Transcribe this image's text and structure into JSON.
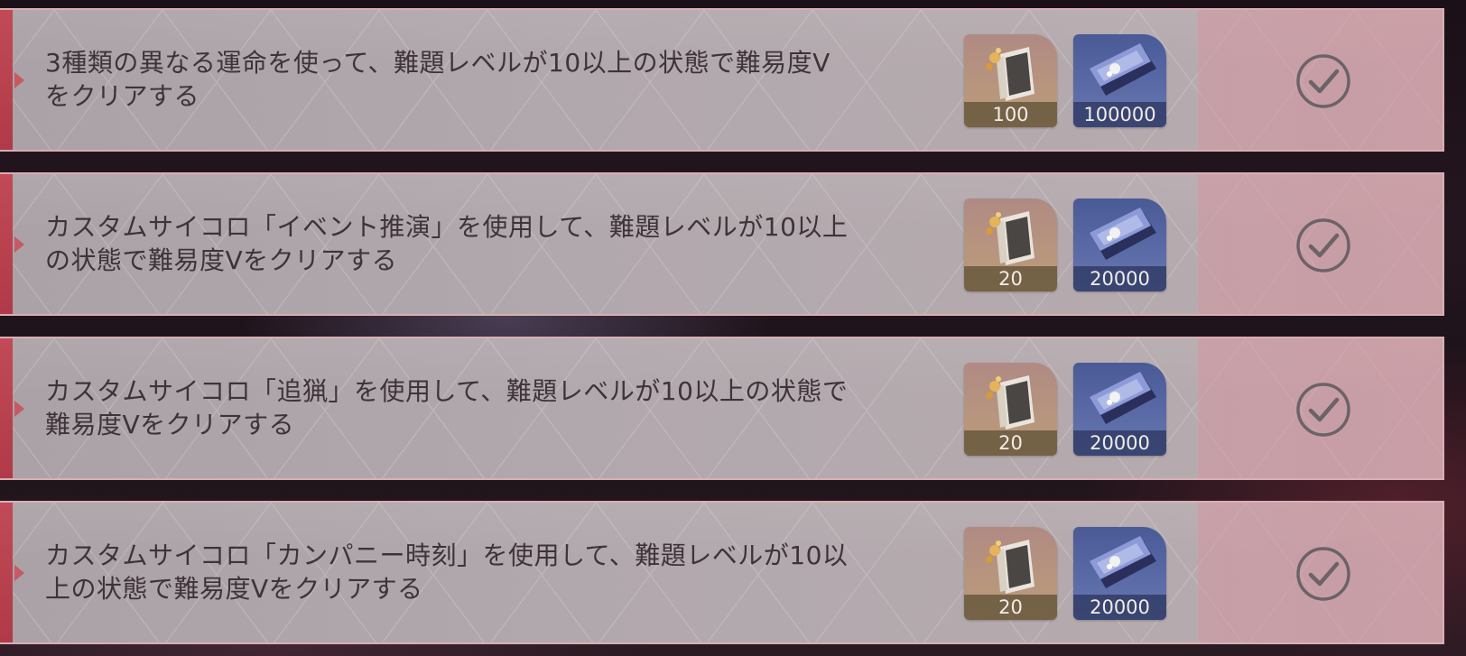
{
  "missions": [
    {
      "description": "3種類の異なる運命を使って、難題レベルが10以上の状態で難易度V\nをクリアする",
      "rewards": [
        {
          "icon": "book-icon",
          "count": "100"
        },
        {
          "icon": "pass-card-icon",
          "count": "100000"
        }
      ],
      "status": "completed"
    },
    {
      "description": "カスタムサイコロ「イベント推演」を使用して、難題レベルが10以上\nの状態で難易度Vをクリアする",
      "rewards": [
        {
          "icon": "book-icon",
          "count": "20"
        },
        {
          "icon": "pass-card-icon",
          "count": "20000"
        }
      ],
      "status": "completed"
    },
    {
      "description": "カスタムサイコロ「追猟」を使用して、難題レベルが10以上の状態で\n難易度Vをクリアする",
      "rewards": [
        {
          "icon": "book-icon",
          "count": "20"
        },
        {
          "icon": "pass-card-icon",
          "count": "20000"
        }
      ],
      "status": "completed"
    },
    {
      "description": "カスタムサイコロ「カンパニー時刻」を使用して、難題レベルが10以\n上の状態で難易度Vをクリアする",
      "rewards": [
        {
          "icon": "book-icon",
          "count": "20"
        },
        {
          "icon": "pass-card-icon",
          "count": "20000"
        }
      ],
      "status": "completed"
    }
  ],
  "colors": {
    "accent": "#c24a56",
    "row_background": "#b1a8ad",
    "text": "#3e3338",
    "check": "#6b6367"
  }
}
